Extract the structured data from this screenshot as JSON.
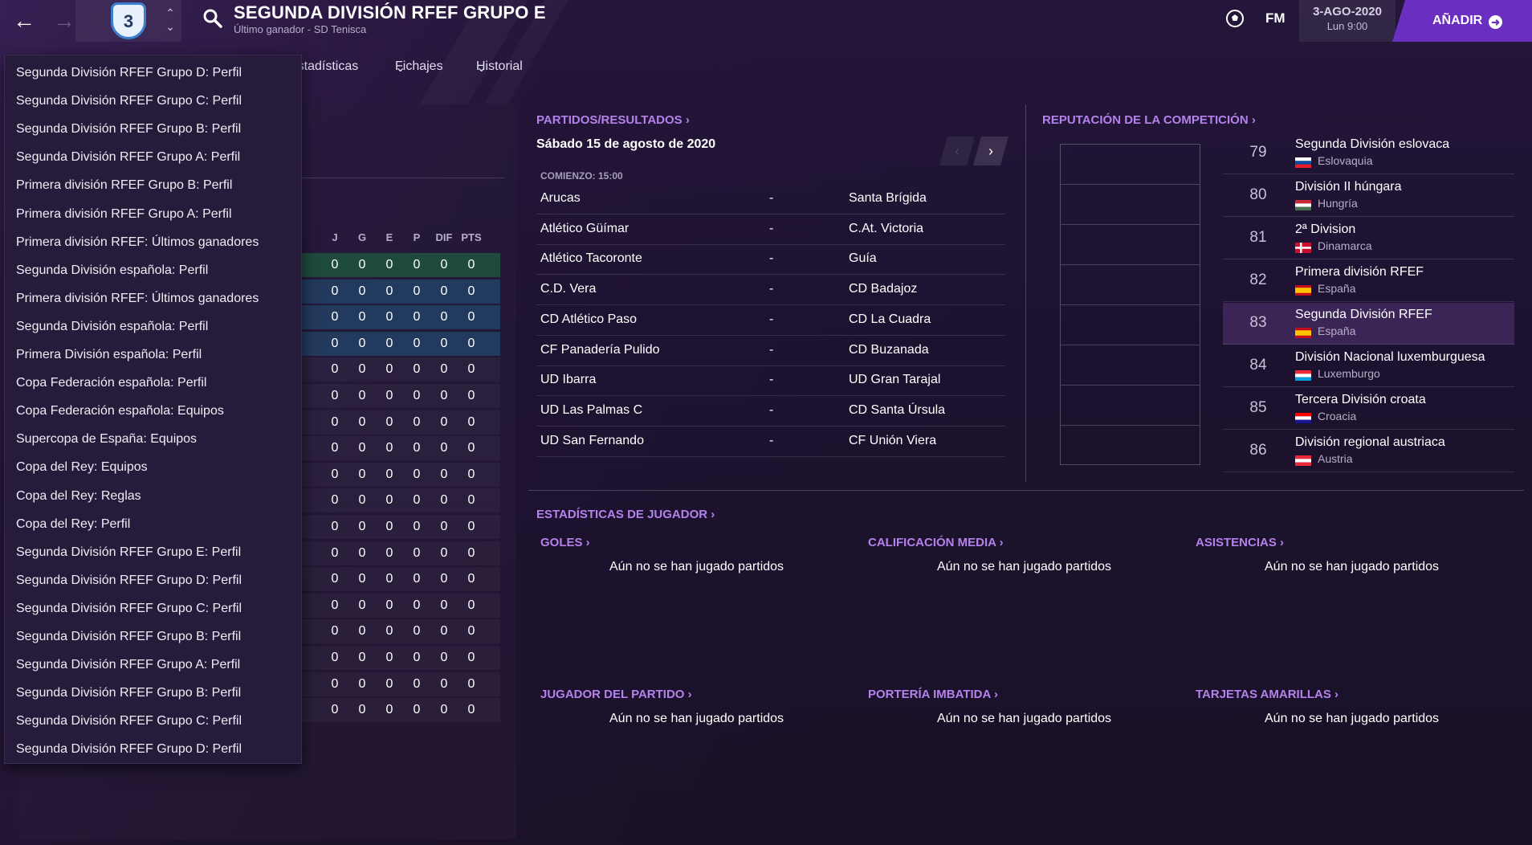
{
  "header": {
    "title": "SEGUNDA DIVISIÓN RFEF GRUPO E",
    "subtitle": "Último ganador - SD Tenisca",
    "badge_text": "3",
    "fm_logo": "FM",
    "date": "3-AGO-2020",
    "time": "Lun 9:00",
    "add_label": "AÑADIR"
  },
  "subtabs": [
    "Estadísticas",
    "Fichajes",
    "Historial"
  ],
  "dropdown": [
    "Segunda División RFEF Grupo D: Perfil",
    "Segunda División RFEF Grupo C: Perfil",
    "Segunda División RFEF Grupo B: Perfil",
    "Segunda División RFEF Grupo A: Perfil",
    "Primera división RFEF Grupo B: Perfil",
    "Primera división RFEF Grupo A: Perfil",
    "Primera división RFEF: Últimos ganadores",
    "Segunda División española: Perfil",
    "Primera división RFEF: Últimos ganadores",
    "Segunda División española: Perfil",
    "Primera División española: Perfil",
    "Copa Federación española: Perfil",
    "Copa Federación española: Equipos",
    "Supercopa de España: Equipos",
    "Copa del Rey: Equipos",
    "Copa del Rey: Reglas",
    "Copa del Rey: Perfil",
    "Segunda División RFEF Grupo E: Perfil",
    "Segunda División RFEF Grupo D: Perfil",
    "Segunda División RFEF Grupo C: Perfil",
    "Segunda División RFEF Grupo B: Perfil",
    "Segunda División RFEF Grupo A: Perfil",
    "Segunda División RFEF Grupo B: Perfil",
    "Segunda División RFEF Grupo C: Perfil",
    "Segunda División RFEF Grupo D: Perfil"
  ],
  "league_table": {
    "columns": [
      "J",
      "G",
      "E",
      "P",
      "DIF",
      "PTS"
    ],
    "rows": [
      [
        "0",
        "0",
        "0",
        "0",
        "0",
        "0"
      ],
      [
        "0",
        "0",
        "0",
        "0",
        "0",
        "0"
      ],
      [
        "0",
        "0",
        "0",
        "0",
        "0",
        "0"
      ],
      [
        "0",
        "0",
        "0",
        "0",
        "0",
        "0"
      ],
      [
        "0",
        "0",
        "0",
        "0",
        "0",
        "0"
      ],
      [
        "0",
        "0",
        "0",
        "0",
        "0",
        "0"
      ],
      [
        "0",
        "0",
        "0",
        "0",
        "0",
        "0"
      ],
      [
        "0",
        "0",
        "0",
        "0",
        "0",
        "0"
      ],
      [
        "0",
        "0",
        "0",
        "0",
        "0",
        "0"
      ],
      [
        "0",
        "0",
        "0",
        "0",
        "0",
        "0"
      ],
      [
        "0",
        "0",
        "0",
        "0",
        "0",
        "0"
      ],
      [
        "0",
        "0",
        "0",
        "0",
        "0",
        "0"
      ],
      [
        "0",
        "0",
        "0",
        "0",
        "0",
        "0"
      ],
      [
        "0",
        "0",
        "0",
        "0",
        "0",
        "0"
      ],
      [
        "0",
        "0",
        "0",
        "0",
        "0",
        "0"
      ],
      [
        "0",
        "0",
        "0",
        "0",
        "0",
        "0"
      ],
      [
        "0",
        "0",
        "0",
        "0",
        "0",
        "0"
      ],
      [
        "0",
        "0",
        "0",
        "0",
        "0",
        "0"
      ]
    ],
    "row_types": [
      "promo",
      "playoff",
      "playoff",
      "playoff",
      "norm",
      "norm",
      "norm",
      "norm",
      "norm",
      "norm",
      "norm",
      "norm",
      "norm",
      "norm",
      "norm",
      "norm",
      "norm",
      "norm"
    ]
  },
  "fixtures": {
    "title": "PARTIDOS/RESULTADOS",
    "date": "Sábado 15 de agosto de 2020",
    "kickoff": "COMIENZO: 15:00",
    "matches": [
      {
        "home": "Arucas",
        "sep": "-",
        "away": "Santa Brígida"
      },
      {
        "home": "Atlético Güímar",
        "sep": "-",
        "away": "C.At. Victoria"
      },
      {
        "home": "Atlético Tacoronte",
        "sep": "-",
        "away": "Guía"
      },
      {
        "home": "C.D. Vera",
        "sep": "-",
        "away": "CD Badajoz"
      },
      {
        "home": "CD Atlético Paso",
        "sep": "-",
        "away": "CD La Cuadra"
      },
      {
        "home": "CF Panadería Pulido",
        "sep": "-",
        "away": "CD Buzanada"
      },
      {
        "home": "UD Ibarra",
        "sep": "-",
        "away": "UD Gran Tarajal"
      },
      {
        "home": "UD Las Palmas C",
        "sep": "-",
        "away": "CD Santa Úrsula"
      },
      {
        "home": "UD San Fernando",
        "sep": "-",
        "away": "CF Unión Viera"
      }
    ]
  },
  "reputation": {
    "title": "REPUTACIÓN DE LA COMPETICIÓN",
    "rows": [
      {
        "rank": "79",
        "name": "Segunda División eslovaca",
        "country": "Eslovaquia",
        "flag": "sk"
      },
      {
        "rank": "80",
        "name": "División II húngara",
        "country": "Hungría",
        "flag": "hu"
      },
      {
        "rank": "81",
        "name": "2ª Division",
        "country": "Dinamarca",
        "flag": "dk"
      },
      {
        "rank": "82",
        "name": "Primera división RFEF",
        "country": "España",
        "flag": "es"
      },
      {
        "rank": "83",
        "name": "Segunda División RFEF",
        "country": "España",
        "flag": "es",
        "highlighted": true
      },
      {
        "rank": "84",
        "name": "División Nacional luxemburguesa",
        "country": "Luxemburgo",
        "flag": "lu"
      },
      {
        "rank": "85",
        "name": "Tercera División croata",
        "country": "Croacia",
        "flag": "hr"
      },
      {
        "rank": "86",
        "name": "División regional austriaca",
        "country": "Austria",
        "flag": "at"
      }
    ]
  },
  "player_stats": {
    "title": "ESTADÍSTICAS DE JUGADOR",
    "blocks": [
      {
        "title": "GOLES",
        "message": "Aún no se han jugado partidos"
      },
      {
        "title": "CALIFICACIÓN MEDIA",
        "message": "Aún no se han jugado partidos"
      },
      {
        "title": "ASISTENCIAS",
        "message": "Aún no se han jugado partidos"
      },
      {
        "title": "JUGADOR DEL PARTIDO",
        "message": "Aún no se han jugado partidos"
      },
      {
        "title": "PORTERÍA IMBATIDA",
        "message": "Aún no se han jugado partidos"
      },
      {
        "title": "TARJETAS AMARILLAS",
        "message": "Aún no se han jugado partidos"
      }
    ]
  },
  "colors": {
    "accent": "#6a2ec0",
    "section_title": "#b581ea",
    "promo_row": "#1f4a3e",
    "playoff_row": "#223a5e"
  }
}
